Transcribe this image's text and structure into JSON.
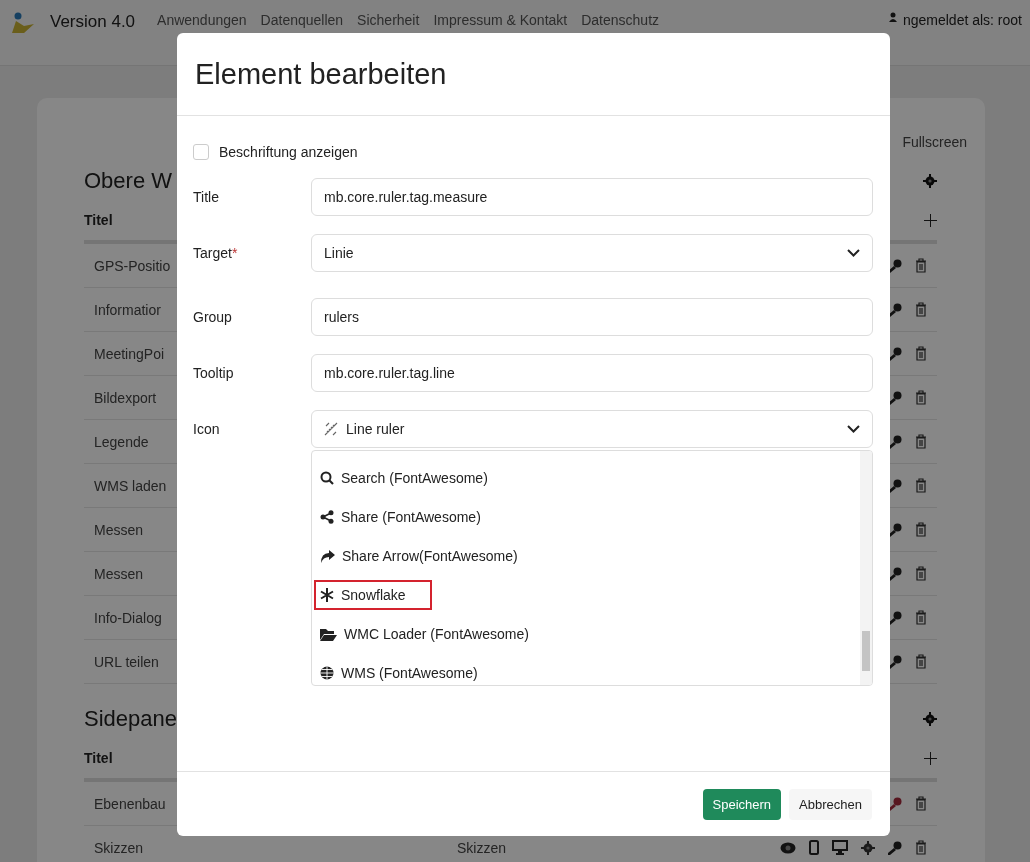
{
  "topbar": {
    "version": "Version 4.0",
    "nav": [
      "Anwendungen",
      "Datenquellen",
      "Sicherheit",
      "Impressum & Kontakt",
      "Datenschutz"
    ],
    "user": "ngemeldet als: root"
  },
  "background": {
    "corner_label": "Fullscreen",
    "sections": [
      {
        "heading": "Obere W",
        "column": "Titel",
        "rows": [
          {
            "title": "GPS-Positio",
            "key_active": false
          },
          {
            "title": "Informatior",
            "key_active": false
          },
          {
            "title": "MeetingPoi",
            "key_active": false
          },
          {
            "title": "Bildexport",
            "key_active": false
          },
          {
            "title": "Legende",
            "key_active": false
          },
          {
            "title": "WMS laden",
            "key_active": false
          },
          {
            "title": "Messen",
            "key_active": false
          },
          {
            "title": "Messen",
            "key_active": false
          },
          {
            "title": "Info-Dialog",
            "key_active": false
          },
          {
            "title": "URL teilen",
            "key_active": false
          }
        ]
      },
      {
        "heading": "Sidepane",
        "column": "Titel",
        "rows": [
          {
            "title": "Ebenenbau",
            "key_active": true
          },
          {
            "title": "Skizzen",
            "middle": "Skizzen",
            "views": true,
            "key_active": false
          }
        ]
      }
    ]
  },
  "dialog": {
    "title": "Element bearbeiten",
    "checkbox": {
      "label": "Beschriftung anzeigen",
      "checked": false
    },
    "fields": [
      {
        "label": "Title",
        "kind": "text",
        "value": "mb.core.ruler.tag.measure"
      },
      {
        "label": "Target",
        "kind": "select",
        "required_mark": "*",
        "value": "Linie"
      },
      {
        "label": "Group",
        "kind": "text",
        "value": "rulers"
      },
      {
        "label": "Tooltip",
        "kind": "text",
        "value": "mb.core.ruler.tag.line"
      },
      {
        "label": "Icon",
        "kind": "iconselect",
        "value": "Line ruler"
      }
    ],
    "options": [
      {
        "label": "Search (FontAwesome)",
        "kind": "search",
        "highlighted": false
      },
      {
        "label": "Share (FontAwesome)",
        "kind": "share",
        "highlighted": false
      },
      {
        "label": "Share Arrow(FontAwesome)",
        "kind": "arrow",
        "highlighted": false
      },
      {
        "label": "Snowflake",
        "kind": "snowflake",
        "highlighted": true
      },
      {
        "label": "WMC Loader (FontAwesome)",
        "kind": "folder",
        "highlighted": false
      },
      {
        "label": "WMS (FontAwesome)",
        "kind": "globe",
        "highlighted": false
      }
    ],
    "buttons": [
      {
        "label": "Speichern",
        "kind": "primary"
      },
      {
        "label": "Abbrechen",
        "kind": "secondary"
      }
    ]
  }
}
